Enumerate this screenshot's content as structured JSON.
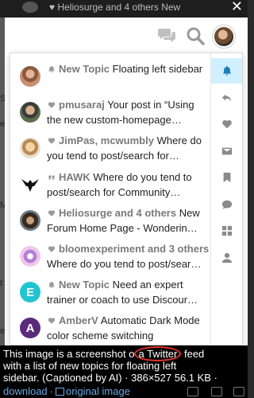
{
  "background": {
    "top_notification": "Heliosurge and 4 others New",
    "close_glyph": "✕",
    "left_fragments": [
      "Sla",
      "e",
      "M",
      "t",
      "e"
    ]
  },
  "header": {
    "icons": [
      "chat-bubbles-icon",
      "search-icon",
      "user-avatar"
    ]
  },
  "notifications": [
    {
      "kind": "bell-icon",
      "avatar": "avatar-photo-woman",
      "who": "New Topic",
      "line1_rest": "Floating left sidebar",
      "line2": ""
    },
    {
      "kind": "heart-icon",
      "avatar": "avatar-photo-man",
      "who": "pmusaraj",
      "line1_rest": "Your post in “Using",
      "line2": "the new custom-homepage…"
    },
    {
      "kind": "heart-icon",
      "avatar": "avatar-photo-cartoon",
      "who": "JimPas, mcwumbly",
      "line1_rest": "Where do",
      "line2": "you tend to post/search for…"
    },
    {
      "kind": "quote-icon",
      "avatar": "avatar-logo-hawk",
      "who": "HAWK",
      "line1_rest": "Where do you tend to",
      "line2": "post/search for Community…"
    },
    {
      "kind": "heart-icon",
      "avatar": "avatar-photo-hat",
      "who": "Heliosurge and 4 others",
      "line1_rest": "New",
      "line2": "Forum Home Page - Wonderin…"
    },
    {
      "kind": "heart-icon",
      "avatar": "avatar-robot-pink",
      "who": "bloomexperiment and 3 others",
      "line1_rest": "",
      "line2": "Where do you tend to post/sear…"
    },
    {
      "kind": "bell-icon",
      "avatar": "avatar-letter-e",
      "avatar_letter": "E",
      "who": "New Topic",
      "line1_rest": "Need an expert",
      "line2": "trainer or coach to use Discour…"
    },
    {
      "kind": "heart-icon",
      "avatar": "avatar-letter-a",
      "avatar_letter": "A",
      "who": "AmberV",
      "line1_rest": "Automatic Dark Mode",
      "line2": "color scheme switching"
    }
  ],
  "rail": [
    {
      "name": "bell-icon",
      "active": true
    },
    {
      "name": "reply-icon",
      "active": false
    },
    {
      "name": "heart-icon",
      "active": false
    },
    {
      "name": "envelope-icon",
      "active": false
    },
    {
      "name": "bookmark-icon",
      "active": false
    },
    {
      "name": "chat-icon",
      "active": false
    },
    {
      "name": "grid-icon",
      "active": false
    },
    {
      "name": "user-icon",
      "active": false
    }
  ],
  "caption": {
    "line1_pre": "This image is a screenshot o",
    "line1_highlight": "a Twitter",
    "line1_post": " feed",
    "line2": "with a list of new topics for floating left",
    "line3": "sidebar. (Captioned by AI) · 386×527 56.1 KB ·",
    "link_download": "download",
    "link_original": "original image"
  },
  "colors": {
    "accent_active_bg": "#d1f0ff",
    "accent_active_icon": "#1c7fb8",
    "muted_text": "#7a7a7a",
    "caption_highlight": "#e0332a"
  }
}
